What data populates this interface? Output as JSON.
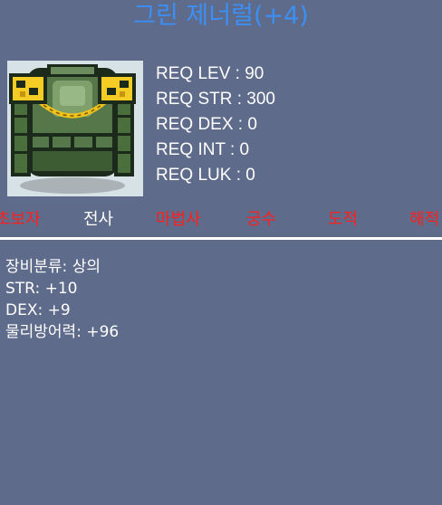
{
  "item": {
    "name": "그린 제너럴(+4)",
    "icon": "armor-icon",
    "name_color": "#3b8ff5"
  },
  "requirements": [
    "REQ LEV : 90",
    "REQ STR : 300",
    "REQ DEX : 0",
    "REQ INT : 0",
    "REQ LUK : 0"
  ],
  "jobs": [
    {
      "label": "초보자",
      "allowed": false
    },
    {
      "label": "전사",
      "allowed": true
    },
    {
      "label": "마법사",
      "allowed": false
    },
    {
      "label": "궁수",
      "allowed": false
    },
    {
      "label": "도적",
      "allowed": false
    },
    {
      "label": "해적",
      "allowed": false
    }
  ],
  "job_colors": {
    "allowed": "#ffffff",
    "denied": "#ff1f1f"
  },
  "stats": [
    "장비분류: 상의",
    "STR: +10",
    "DEX: +9",
    "물리방어력: +96"
  ],
  "background_color": "#5e6b8a"
}
